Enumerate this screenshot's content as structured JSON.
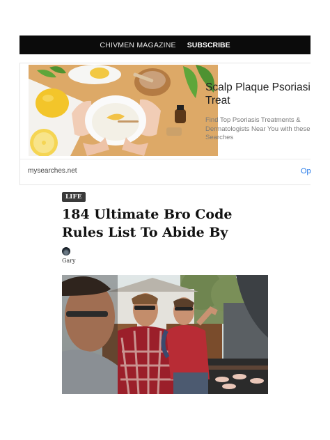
{
  "header": {
    "brand": "CHIVMEN MAGAZINE",
    "subscribe_label": "SUBSCRIBE"
  },
  "ad": {
    "title": "Scalp Plaque Psoriasis Treat",
    "description": "Find Top Psoriasis Treatments & Dermatologists Near You with these Searches",
    "source": "mysearches.net",
    "open_label": "Op"
  },
  "article": {
    "category": "LIFE",
    "title": "184 Ultimate Bro Code Rules List To Abide By",
    "author": "Gary"
  },
  "colors": {
    "topbar": "#0b0b0b",
    "badge": "#3a3a3a",
    "link": "#1a73e8"
  }
}
